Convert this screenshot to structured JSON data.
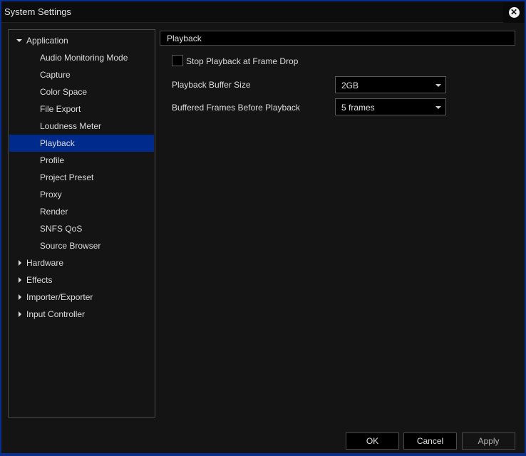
{
  "window": {
    "title": "System Settings",
    "close_icon": "close-circle-icon"
  },
  "tree": {
    "items": [
      {
        "label": "Application",
        "level": 0,
        "expanded": true,
        "selected": false
      },
      {
        "label": "Audio Monitoring Mode",
        "level": 1,
        "selected": false
      },
      {
        "label": "Capture",
        "level": 1,
        "selected": false
      },
      {
        "label": "Color Space",
        "level": 1,
        "selected": false
      },
      {
        "label": "File Export",
        "level": 1,
        "selected": false
      },
      {
        "label": "Loudness Meter",
        "level": 1,
        "selected": false
      },
      {
        "label": "Playback",
        "level": 1,
        "selected": true
      },
      {
        "label": "Profile",
        "level": 1,
        "selected": false
      },
      {
        "label": "Project Preset",
        "level": 1,
        "selected": false
      },
      {
        "label": "Proxy",
        "level": 1,
        "selected": false
      },
      {
        "label": "Render",
        "level": 1,
        "selected": false
      },
      {
        "label": "SNFS QoS",
        "level": 1,
        "selected": false
      },
      {
        "label": "Source Browser",
        "level": 1,
        "selected": false
      },
      {
        "label": "Hardware",
        "level": 0,
        "expanded": false,
        "selected": false
      },
      {
        "label": "Effects",
        "level": 0,
        "expanded": false,
        "selected": false
      },
      {
        "label": "Importer/Exporter",
        "level": 0,
        "expanded": false,
        "selected": false
      },
      {
        "label": "Input Controller",
        "level": 0,
        "expanded": false,
        "selected": false
      }
    ]
  },
  "panel": {
    "header": "Playback",
    "stop_playback_checkbox": {
      "label": "Stop Playback at Frame Drop",
      "checked": false
    },
    "buffer_size": {
      "label": "Playback Buffer Size",
      "value": "2GB"
    },
    "buffered_frames": {
      "label": "Buffered Frames Before Playback",
      "value": "5 frames"
    }
  },
  "footer": {
    "ok_label": "OK",
    "cancel_label": "Cancel",
    "apply_label": "Apply",
    "apply_enabled": false
  },
  "colors": {
    "accent": "#0a2f8a",
    "selection": "#002a8c",
    "background": "#141414"
  }
}
